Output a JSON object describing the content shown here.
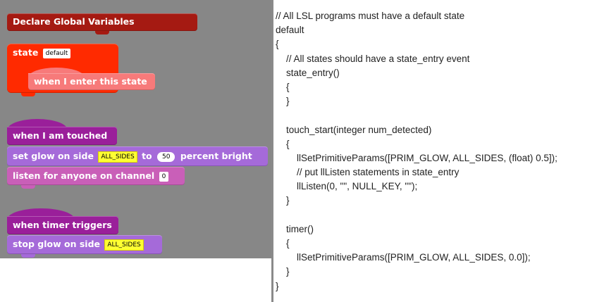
{
  "blocks": {
    "declare_globals": "Declare Global Variables",
    "state_label": "state",
    "state_name": "default",
    "state_entry": "when I enter this state",
    "touched": "when I am touched",
    "glow_prefix": "set glow on side",
    "glow_side": "ALL_SIDES",
    "glow_to": "to",
    "glow_value": "50",
    "glow_suffix": "percent bright",
    "listen_prefix": "listen for anyone on channel",
    "listen_channel": "0",
    "timer": "when timer triggers",
    "stop_prefix": "stop glow on side",
    "stop_side": "ALL_SIDES"
  },
  "code_lines": [
    "// All LSL programs must have a default state",
    "default",
    "{",
    "    // All states should have a state_entry event",
    "    state_entry()",
    "    {",
    "    }",
    "",
    "    touch_start(integer num_detected)",
    "    {",
    "        llSetPrimitiveParams([PRIM_GLOW, ALL_SIDES, (float) 0.5]);",
    "        // put llListen statements in state_entry",
    "        llListen(0, \"\", NULL_KEY, \"\");",
    "    }",
    "",
    "    timer()",
    "    {",
    "        llSetPrimitiveParams([PRIM_GLOW, ALL_SIDES, 0.0]);",
    "    }",
    "}"
  ],
  "colors": {
    "canvas": "#878787",
    "declare": "#a51a12",
    "state": "#ff2a00",
    "state_entry": "#f77a7a",
    "event": "#9a1f9a",
    "action": "#a56ad9",
    "listen": "#c95fb8"
  }
}
